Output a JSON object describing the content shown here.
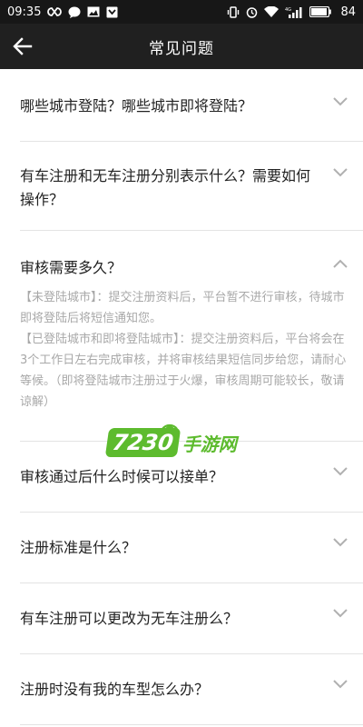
{
  "status_bar": {
    "time": "09:35",
    "battery": "84",
    "icons_left": [
      "link-icon",
      "chat-icon",
      "image-icon",
      "notification-icon"
    ],
    "icons_right": [
      "vibrate-icon",
      "alarm-icon",
      "wifi-icon",
      "signal-4g-icon",
      "battery-icon"
    ],
    "network": "4G"
  },
  "app_bar": {
    "title": "常见问题",
    "back_icon": "back-arrow-icon"
  },
  "faq": [
    {
      "question": "哪些城市登陆？哪些城市即将登陆？",
      "expanded": false
    },
    {
      "question": "有车注册和无车注册分别表示什么？需要如何操作？",
      "expanded": false
    },
    {
      "question": "审核需要多久？",
      "expanded": true,
      "answer": [
        "【未登陆城市】：提交注册资料后，平台暂不进行审核，待城市即将登陆后将短信通知您。",
        "【已登陆城市和即将登陆城市】：提交注册资料后，平台将会在3个工作日左右完成审核，并将审核结果短信同步给您，请耐心等候。（即将登陆城市注册过于火爆，审核周期可能较长，敬请谅解）"
      ]
    },
    {
      "question": "审核通过后什么时候可以接单？",
      "expanded": false
    },
    {
      "question": "注册标准是什么？",
      "expanded": false
    },
    {
      "question": "有车注册可以更改为无车注册么？",
      "expanded": false
    },
    {
      "question": "注册时没有我的车型怎么办？",
      "expanded": false
    }
  ],
  "watermark": {
    "number": "7230",
    "text": "手游网"
  },
  "colors": {
    "status_bar_bg": "#171717",
    "app_bar_bg": "#202020",
    "question_text": "#222222",
    "answer_text": "#a8a8a8",
    "divider": "#e3e3e3",
    "watermark_green": "#5dbb2e"
  }
}
